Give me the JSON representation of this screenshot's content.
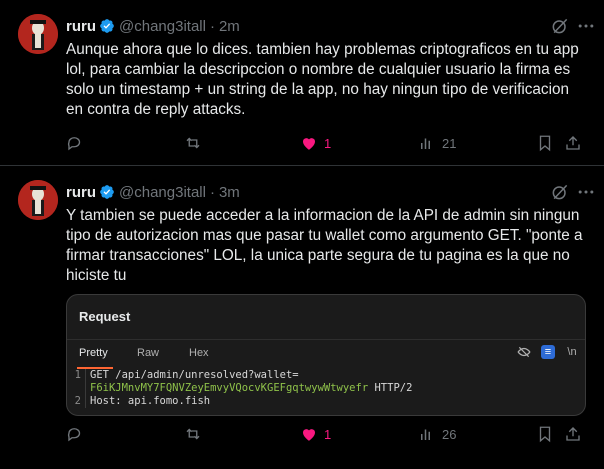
{
  "tweets": [
    {
      "name": "ruru",
      "handle": "@chang3itall",
      "separator": "·",
      "time": "2m",
      "text": "Aunque ahora que lo dices. tambien hay problemas criptograficos en tu app lol, para cambiar la descripccion o nombre de cualquier usuario la firma es solo un timestamp + un string de la app, no hay ningun tipo de verificacion en contra de reply attacks.",
      "likes": "1",
      "views": "21"
    },
    {
      "name": "ruru",
      "handle": "@chang3itall",
      "separator": "·",
      "time": "3m",
      "text": "Y tambien se puede acceder a la informacion de la API de admin sin ningun tipo de autorizacion mas que pasar tu wallet como argumento GET. \"ponte a firmar transacciones\" LOL, la unica parte segura de tu pagina es la que no hiciste tu",
      "likes": "1",
      "views": "26",
      "card": {
        "title": "Request",
        "tabs": [
          "Pretty",
          "Raw",
          "Hex"
        ],
        "icon_label": "\\n",
        "lines": [
          {
            "num": "1",
            "parts": [
              {
                "t": "GET /api/admin/unresolved?wallet=",
                "c": "plain"
              }
            ]
          },
          {
            "num": "",
            "parts": [
              {
                "t": "F6iKJMnvMY7FQNVZeyEmvyVQocvKGEFgqtwywWtwyefr",
                "c": "param"
              },
              {
                "t": " HTTP/2",
                "c": "plain"
              }
            ]
          },
          {
            "num": "2",
            "parts": [
              {
                "t": "Host: api.fomo.fish",
                "c": "plain"
              }
            ]
          }
        ]
      }
    }
  ],
  "colors": {
    "accent_like": "#f91880",
    "verified": "#1d9bf0",
    "muted": "#71767b",
    "burp_orange": "#ff6633"
  }
}
